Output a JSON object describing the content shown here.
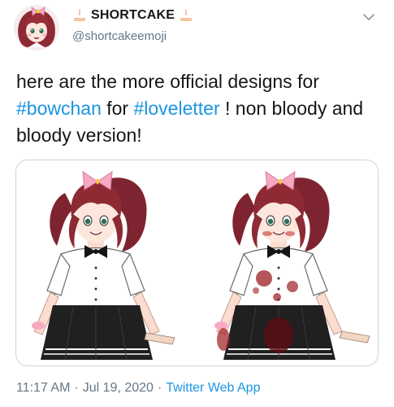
{
  "tweet": {
    "author": {
      "display_name": "SHORTCAKE",
      "handle": "@shortcakeemoji",
      "name_emoji": "cake-icon",
      "avatar": "avatar-drawing"
    },
    "menu_icon": "chevron-down-icon",
    "text": {
      "part1": "here are the more official designs for",
      "hashtag1": "#bowchan",
      "part2": "for",
      "hashtag2": "#loveletter",
      "part3": "! non bloody and bloody version!"
    },
    "media": {
      "description": "illustration"
    },
    "meta": {
      "time": "11:17 AM",
      "separator1": "·",
      "date": "Jul 19, 2020",
      "separator2": "·",
      "source": "Twitter Web App"
    }
  },
  "colors": {
    "text": "#14171a",
    "secondary": "#657786",
    "link": "#1b95e0",
    "border": "#ccd6dd",
    "hair": "#8e2a33",
    "bow": "#f7a9c4",
    "blood": "#9b1c22"
  }
}
